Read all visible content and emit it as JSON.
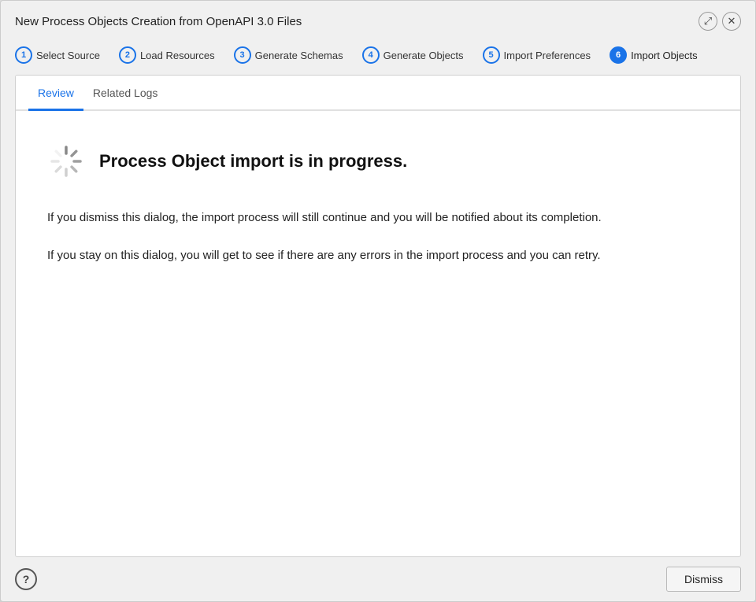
{
  "dialog": {
    "title": "New Process Objects Creation from OpenAPI 3.0 Files"
  },
  "titlebar": {
    "expand_label": "⤢",
    "close_label": "✕"
  },
  "steps": [
    {
      "number": "1",
      "label": "Select Source",
      "active": false
    },
    {
      "number": "2",
      "label": "Load Resources",
      "active": false
    },
    {
      "number": "3",
      "label": "Generate Schemas",
      "active": false
    },
    {
      "number": "4",
      "label": "Generate Objects",
      "active": false
    },
    {
      "number": "5",
      "label": "Import Preferences",
      "active": false
    },
    {
      "number": "6",
      "label": "Import Objects",
      "active": true
    }
  ],
  "tabs": [
    {
      "label": "Review",
      "active": true
    },
    {
      "label": "Related Logs",
      "active": false
    }
  ],
  "main": {
    "status_title": "Process Object import is in progress.",
    "paragraph1": "If you dismiss this dialog, the import process will still continue and you will be notified about its completion.",
    "paragraph2": "If you stay on this dialog, you will get to see if there are any errors in the import process and you can retry."
  },
  "footer": {
    "help_label": "?",
    "dismiss_label": "Dismiss"
  }
}
